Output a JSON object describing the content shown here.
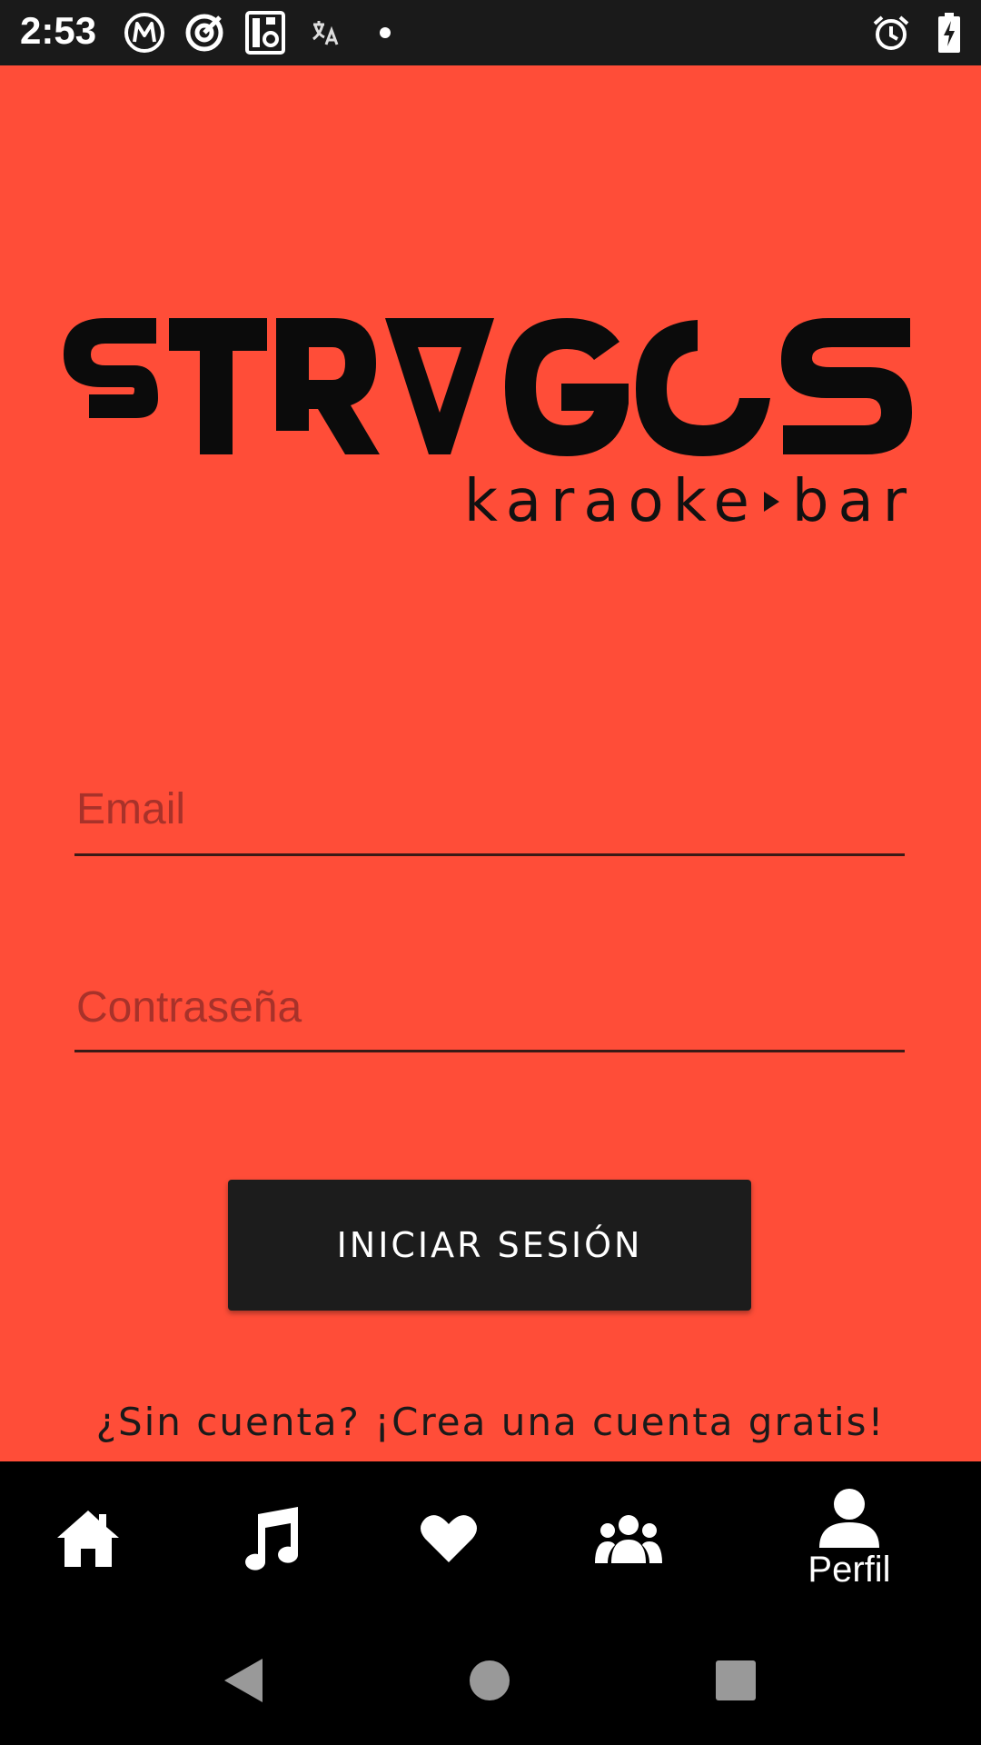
{
  "status_bar": {
    "time": "2:53",
    "icons": [
      "motorola-m-icon",
      "target-icon",
      "media-icon",
      "translate-icon",
      "dot-icon",
      "alarm-icon",
      "battery-charging-icon"
    ]
  },
  "logo": {
    "wordmark": "STRAGOS",
    "subtitle_left": "karaoke",
    "subtitle_right": "bar"
  },
  "form": {
    "email_placeholder": "Email",
    "password_placeholder": "Contraseña",
    "login_button": "INICIAR SESIÓN",
    "signup_text": "¿Sin cuenta? ¡Crea una cuenta gratis!"
  },
  "bottom_nav": {
    "items": [
      {
        "icon": "home-icon",
        "label": ""
      },
      {
        "icon": "music-note-icon",
        "label": ""
      },
      {
        "icon": "heart-icon",
        "label": ""
      },
      {
        "icon": "group-icon",
        "label": ""
      },
      {
        "icon": "person-icon",
        "label": "Perfil",
        "active": true
      }
    ]
  },
  "colors": {
    "background": "#ff4d38",
    "button": "#1c1c1c",
    "nav": "#000000"
  }
}
